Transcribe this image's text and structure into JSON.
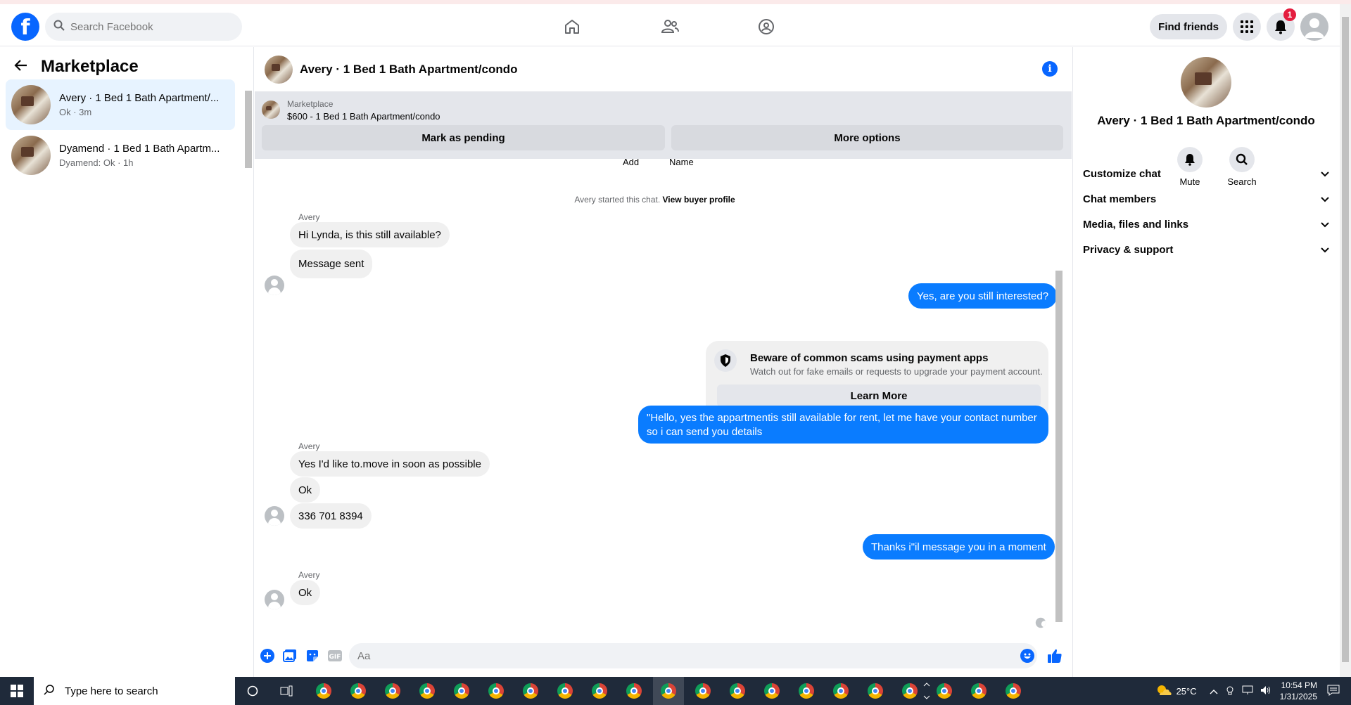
{
  "header": {
    "logo": "f",
    "search_placeholder": "Search Facebook",
    "find_friends_label": "Find friends",
    "notification_count": "1"
  },
  "sidebar": {
    "title": "Marketplace",
    "conversations": [
      {
        "title": "Avery · 1 Bed 1 Bath Apartment/...",
        "subtitle": "Ok · 3m"
      },
      {
        "title": "Dyamend · 1 Bed 1 Bath Apartm...",
        "subtitle": "Dyamend: Ok · 1h"
      }
    ]
  },
  "chat": {
    "title": "Avery · 1 Bed 1 Bath Apartment/condo",
    "listing": {
      "label": "Marketplace",
      "price_title": "$600 - 1 Bed 1 Bath Apartment/condo",
      "mark_pending_label": "Mark as pending",
      "more_options_label": "More options"
    },
    "cut_off_labels": [
      "Add",
      "Name"
    ],
    "system_text": "Avery started this chat.",
    "system_link": "View buyer profile",
    "messages": {
      "sender1": "Avery",
      "m1": "Hi Lynda, is this still available?",
      "m2": "Message sent",
      "m3": "Yes, are you still interested?",
      "scam_title": "Beware of common scams using payment apps",
      "scam_sub": "Watch out for fake emails or requests to upgrade your payment account.",
      "learn_more": "Learn More",
      "m4_line1": "\"Hello, yes the appartmentis still available for rent, let me have your contact number",
      "m4_line2": "so i can send you details",
      "sender2": "Avery",
      "m5": "Yes I'd like to.move in soon as possible",
      "m6": "Ok",
      "m7": "336 701 8394",
      "m8": "Thanks i\"il message you in a moment",
      "sender3": "Avery",
      "m9": "Ok"
    },
    "composer_placeholder": "Aa"
  },
  "details": {
    "title": "Avery · 1 Bed 1 Bath Apartment/condo",
    "mute_label": "Mute",
    "search_label": "Search",
    "sections": [
      "Customize chat",
      "Chat members",
      "Media, files and links",
      "Privacy & support"
    ]
  },
  "taskbar": {
    "search_placeholder": "Type here to search",
    "temperature": "25°C",
    "time": "10:54 PM",
    "date": "1/31/2025"
  },
  "colors": {
    "brand": "#0866ff",
    "my_bubble": "#0a7cff",
    "their_bubble": "#f0f0f0",
    "taskbar": "#1f2a3a"
  }
}
